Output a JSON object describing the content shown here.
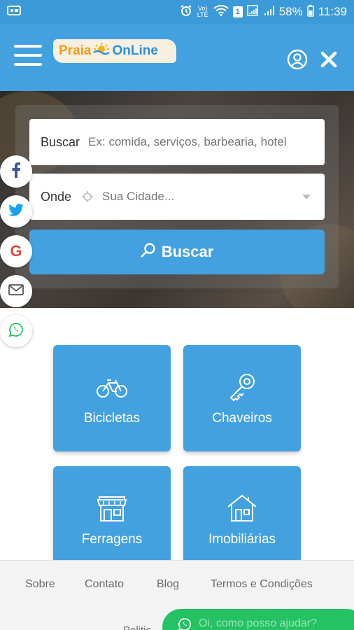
{
  "status_bar": {
    "battery": "58%",
    "time": "11:39",
    "network": "Vo) LTE",
    "sim": "1"
  },
  "header": {
    "logo_part1": "Praia",
    "logo_part2": "OnLine",
    "background_color": "#43a1e0"
  },
  "search": {
    "buscar_label": "Buscar",
    "buscar_placeholder": "Ex: comida, serviços, barbearia, hotel",
    "onde_label": "Onde",
    "onde_placeholder": "Sua Cidade...",
    "button_label": "Buscar"
  },
  "social": {
    "items": [
      "facebook-icon",
      "twitter-icon",
      "google-icon",
      "mail-icon",
      "whatsapp-icon"
    ]
  },
  "categories": [
    {
      "label": "Bicicletas",
      "icon": "bicycle-icon"
    },
    {
      "label": "Chaveiros",
      "icon": "key-icon"
    },
    {
      "label": "Ferragens",
      "icon": "store-icon"
    },
    {
      "label": "Imobiliárias",
      "icon": "house-icon"
    }
  ],
  "footer": {
    "links": [
      "Sobre",
      "Contato",
      "Blog",
      "Termos e Condições"
    ],
    "partial_link": "Politic"
  },
  "whatsapp_chat": {
    "label": "Oi, como posso ajudar?",
    "color": "#25c263"
  }
}
